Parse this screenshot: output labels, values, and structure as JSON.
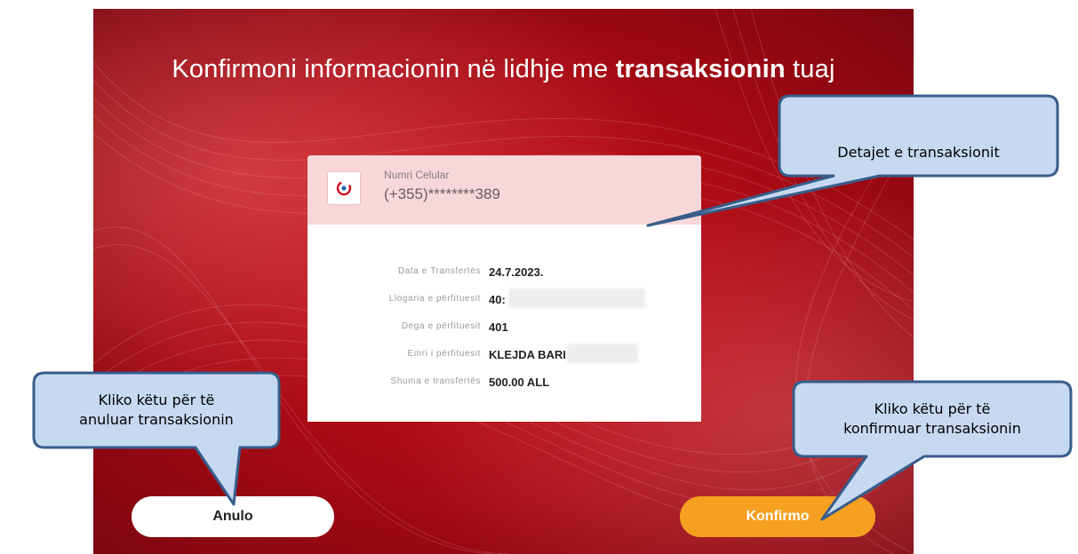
{
  "screen": {
    "title_prefix": "Konfirmoni informacionin në lidhje me ",
    "title_bold": "transaksionin",
    "title_suffix": " tuaj"
  },
  "card": {
    "phone_label": "Numri Celular",
    "phone_value": "(+355)********389",
    "rows": [
      {
        "label": "Data e Transfertës",
        "value": "24.7.2023."
      },
      {
        "label": "Llogaria e përfituesit",
        "value": "40:"
      },
      {
        "label": "Dega e përfituesit",
        "value": "401"
      },
      {
        "label": "Emri i përfituesit",
        "value": "KLEJDA BARI"
      },
      {
        "label": "Shuma e transfertës",
        "value": "500.00 ALL"
      }
    ]
  },
  "buttons": {
    "cancel": "Anulo",
    "confirm": "Konfirmo"
  },
  "callouts": {
    "details": "Detajet e transaksionit",
    "cancel_line1": "Kliko këtu për të",
    "cancel_line2": "anuluar transaksionin",
    "confirm_line1": "Kliko këtu për të",
    "confirm_line2": "konfirmuar transaksionin"
  },
  "colors": {
    "background_red": "#c8101c",
    "card_header": "#f7d7da",
    "confirm_orange": "#f5a020",
    "callout_fill": "#c6d9f1",
    "callout_border": "#385d8a"
  }
}
